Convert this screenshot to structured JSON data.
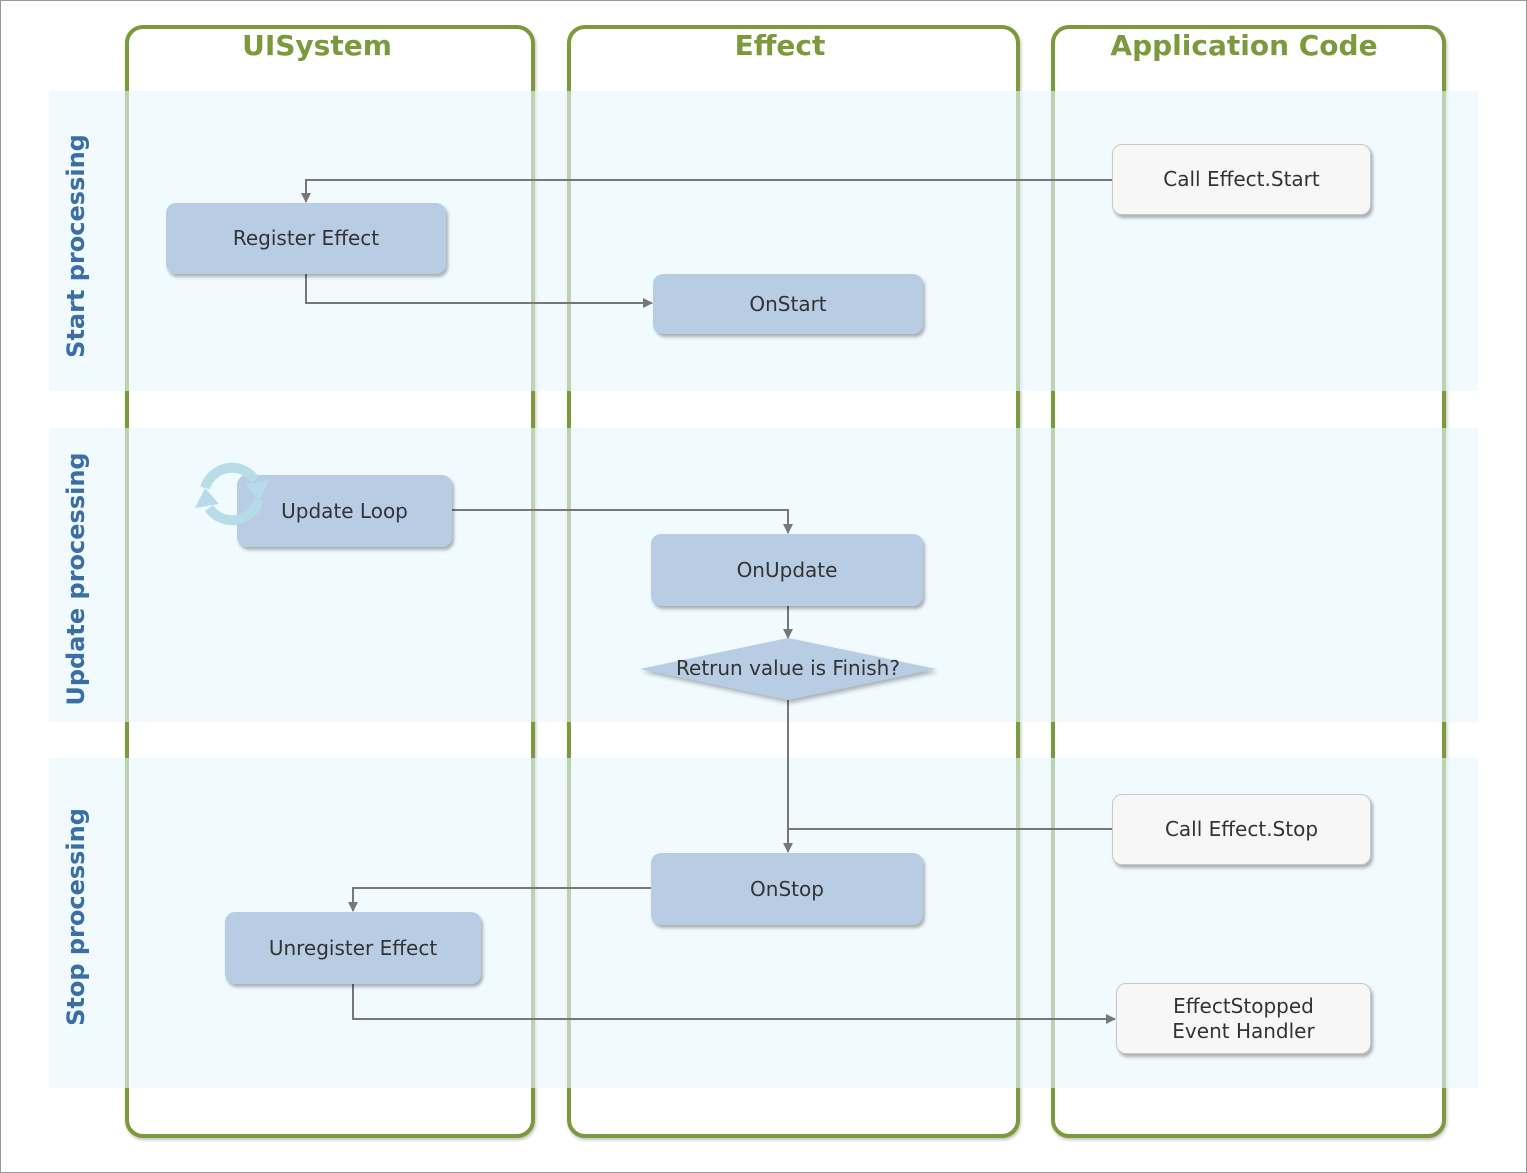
{
  "lanes": [
    "UISystem",
    "Effect",
    "Application Code"
  ],
  "bands": [
    "Start processing",
    "Update processing",
    "Stop processing"
  ],
  "nodes": {
    "register_effect": "Register Effect",
    "on_start": "OnStart",
    "call_effect_start": "Call Effect.Start",
    "update_loop": "Update Loop",
    "on_update": "OnUpdate",
    "decision": "Retrun value is Finish?",
    "call_effect_stop": "Call Effect.Stop",
    "on_stop": "OnStop",
    "unregister_effect": "Unregister Effect",
    "effect_stopped_1": "EffectStopped",
    "effect_stopped_2": "Event Handler"
  },
  "colors": {
    "lane_border": "#7a9a3c",
    "band_label": "#3a6ea5",
    "process_box": "#b8cce4",
    "loop_icon": "#b5dce8",
    "connector": "#777777"
  },
  "icons": {
    "loop": "refresh-loop-icon"
  }
}
